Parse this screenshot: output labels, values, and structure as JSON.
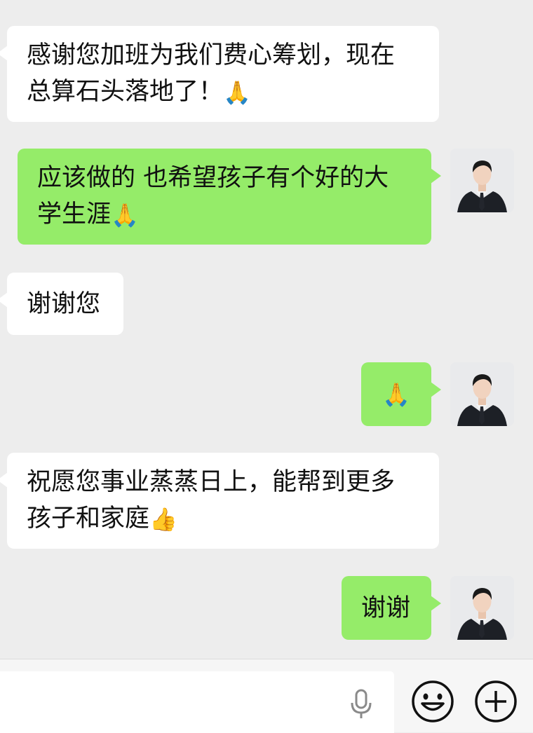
{
  "messages": [
    {
      "side": "in",
      "lines": [
        "感谢您加班为我们费心筹划，现在",
        "总算石头落地了！"
      ],
      "emoji": "🙏"
    },
    {
      "side": "out",
      "lines": [
        "应该做的 也希望孩子有个好的大",
        "学生涯"
      ],
      "emoji": "🙏"
    },
    {
      "side": "in",
      "lines": [
        "谢谢您"
      ],
      "emoji": ""
    },
    {
      "side": "out",
      "lines": [],
      "emoji": "🙏"
    },
    {
      "side": "in",
      "lines": [
        "祝愿您事业蒸蒸日上，能帮到更多",
        "孩子和家庭"
      ],
      "emoji": "👍"
    },
    {
      "side": "out",
      "lines": [
        "谢谢"
      ],
      "emoji": ""
    }
  ],
  "input_bar": {
    "message_value": "",
    "icons": [
      "microphone-icon",
      "emoji-icon",
      "plus-icon"
    ]
  },
  "colors": {
    "background": "#ededed",
    "incoming_bubble": "#ffffff",
    "outgoing_bubble": "#95ec69"
  }
}
